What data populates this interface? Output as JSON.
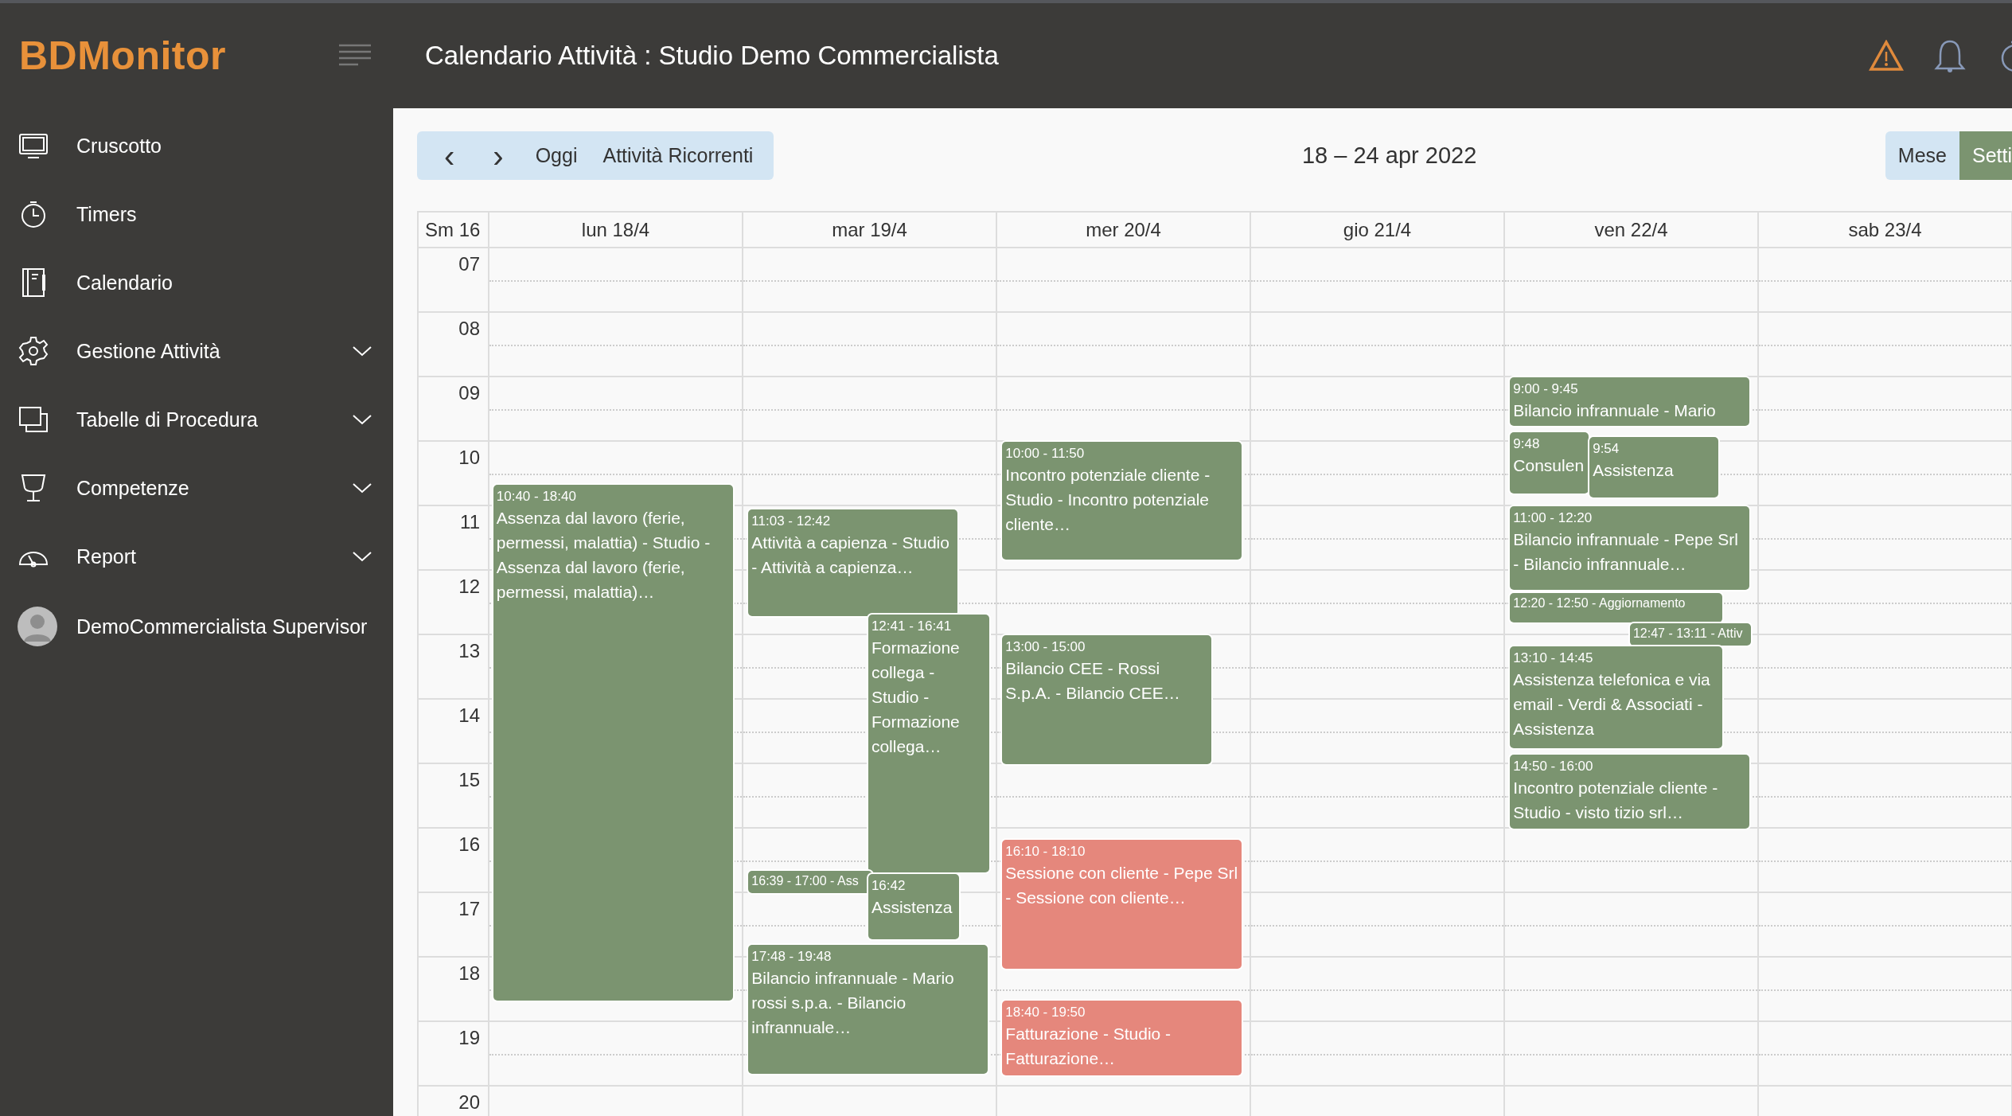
{
  "app": {
    "logo": "BDMonitor",
    "title": "Calendario Attività : Studio Demo Commercialista"
  },
  "sidebar": {
    "items": [
      {
        "label": "Cruscotto",
        "expandable": false
      },
      {
        "label": "Timers",
        "expandable": false
      },
      {
        "label": "Calendario",
        "expandable": false
      },
      {
        "label": "Gestione Attività",
        "expandable": true
      },
      {
        "label": "Tabelle di Procedura",
        "expandable": true
      },
      {
        "label": "Competenze",
        "expandable": true
      },
      {
        "label": "Report",
        "expandable": true
      }
    ],
    "user": "DemoCommercialista Supervisor"
  },
  "toolbar": {
    "prev": "‹",
    "next": "›",
    "today": "Oggi",
    "recurring": "Attività Ricorrenti",
    "range": "18 – 24 apr 2022",
    "views": [
      {
        "label": "Mese",
        "selected": false
      },
      {
        "label": "Setti",
        "selected": true
      }
    ]
  },
  "calendar": {
    "week": "Sm 16",
    "hours": [
      "07",
      "08",
      "09",
      "10",
      "11",
      "12",
      "13",
      "14",
      "15",
      "16",
      "17",
      "18",
      "19",
      "20"
    ],
    "days": [
      {
        "label": "lun 18/4",
        "events": [
          {
            "kind": "block",
            "color": "#7b9470",
            "time": "10:40 - 18:40",
            "title": "Assenza dal lavoro (ferie, permessi, malattia) - Studio - Assenza dal lavoro (ferie, permessi, malattia)…"
          }
        ]
      },
      {
        "label": "mar 19/4",
        "events": [
          {
            "kind": "block",
            "color": "#7b9470",
            "time": "11:03 - 12:42",
            "title": "Attività a capienza - Studio - Attività a capienza…"
          },
          {
            "kind": "block",
            "color": "#7b9470",
            "time": "12:41 - 16:41",
            "title": "Formazione collega - Studio - Formazione collega…"
          },
          {
            "kind": "inline",
            "color": "#7b9470",
            "time": "16:39 - 17:00 - Ass"
          },
          {
            "kind": "block",
            "color": "#7b9470",
            "time": "16:42",
            "title": "Assistenza"
          },
          {
            "kind": "block",
            "color": "#7b9470",
            "time": "17:48 - 19:48",
            "title": "Bilancio infrannuale - Mario rossi s.p.a. - Bilancio infrannuale…"
          }
        ]
      },
      {
        "label": "mer 20/4",
        "events": [
          {
            "kind": "block",
            "color": "#7b9470",
            "time": "10:00 - 11:50",
            "title": "Incontro potenziale cliente - Studio - Incontro potenziale cliente…"
          },
          {
            "kind": "block",
            "color": "#7b9470",
            "time": "13:00 - 15:00",
            "title": "Bilancio CEE - Rossi S.p.A. - Bilancio CEE…"
          },
          {
            "kind": "block",
            "color": "#e5877c",
            "time": "16:10 - 18:10",
            "title": "Sessione con cliente - Pepe Srl - Sessione con cliente…"
          },
          {
            "kind": "block",
            "color": "#e5877c",
            "time": "18:40 - 19:50",
            "title": "Fatturazione - Studio - Fatturazione…"
          }
        ]
      },
      {
        "label": "gio 21/4"
      },
      {
        "label": "ven 22/4",
        "events": [
          {
            "kind": "block",
            "color": "#7b9470",
            "time": "9:00 - 9:45",
            "title": "Bilancio infrannuale - Mario"
          },
          {
            "kind": "block",
            "color": "#7b9470",
            "time": "9:48",
            "title": "Consulen"
          },
          {
            "kind": "block",
            "color": "#7b9470",
            "time": "9:54",
            "title": "Assistenza"
          },
          {
            "kind": "block",
            "color": "#7b9470",
            "time": "11:00 - 12:20",
            "title": "Bilancio infrannuale - Pepe Srl - Bilancio infrannuale…"
          },
          {
            "kind": "inline",
            "color": "#7b9470",
            "time": "12:20 - 12:50 - Aggiornamento"
          },
          {
            "kind": "inline",
            "color": "#7b9470",
            "time": "12:47 - 13:11 - Attiv"
          },
          {
            "kind": "block",
            "color": "#7b9470",
            "time": "13:10 - 14:45",
            "title": "Assistenza telefonica e via email - Verdi & Associati - Assistenza"
          },
          {
            "kind": "block",
            "color": "#7b9470",
            "time": "14:50 - 16:00",
            "title": "Incontro potenziale cliente - Studio - visto tizio srl…"
          }
        ]
      },
      {
        "label": "sab 23/4"
      }
    ]
  }
}
